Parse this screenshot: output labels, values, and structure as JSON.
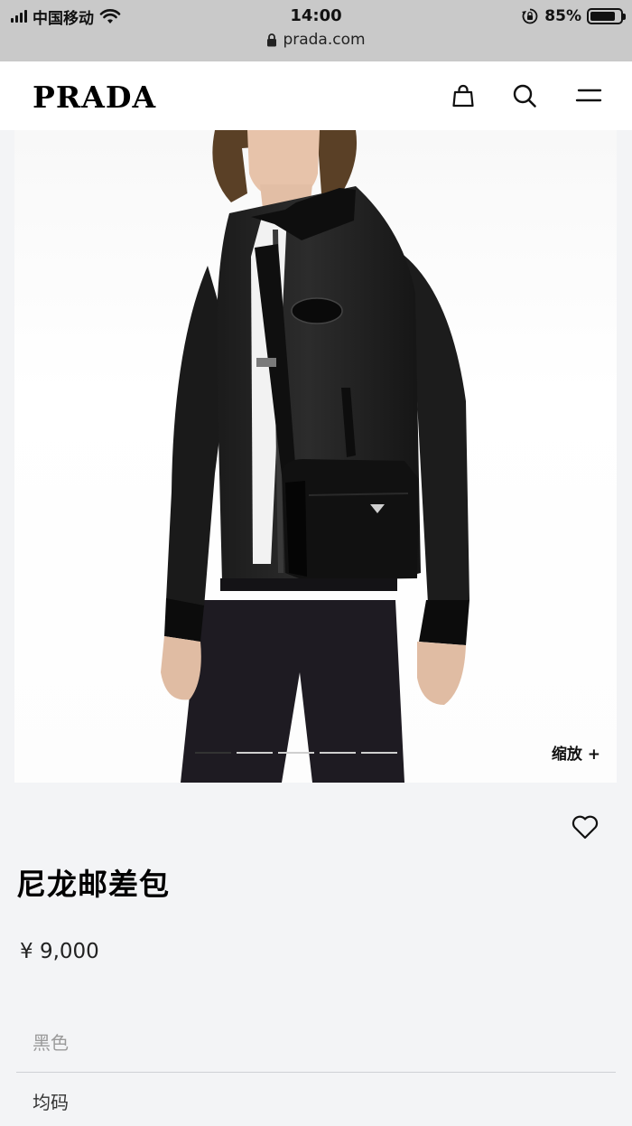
{
  "status_bar": {
    "carrier": "中国移动",
    "time": "14:00",
    "url": "prada.com",
    "battery": "85%",
    "battery_level": 0.85
  },
  "header": {
    "logo": "PRADA",
    "icons": [
      "shopping-bag-icon",
      "search-icon",
      "menu-icon"
    ]
  },
  "gallery": {
    "zoom_label": "缩放 +",
    "slide_count": 5,
    "active_slide": 1
  },
  "product": {
    "name": "尼龙邮差包",
    "price": "¥ 9,000",
    "color": "黑色",
    "size": "均码"
  },
  "colors": {
    "background": "#f3f4f6",
    "header_bg": "#ffffff",
    "status_bg": "#c9c9c9",
    "text": "#111111",
    "muted_text": "#9a9a9a"
  }
}
